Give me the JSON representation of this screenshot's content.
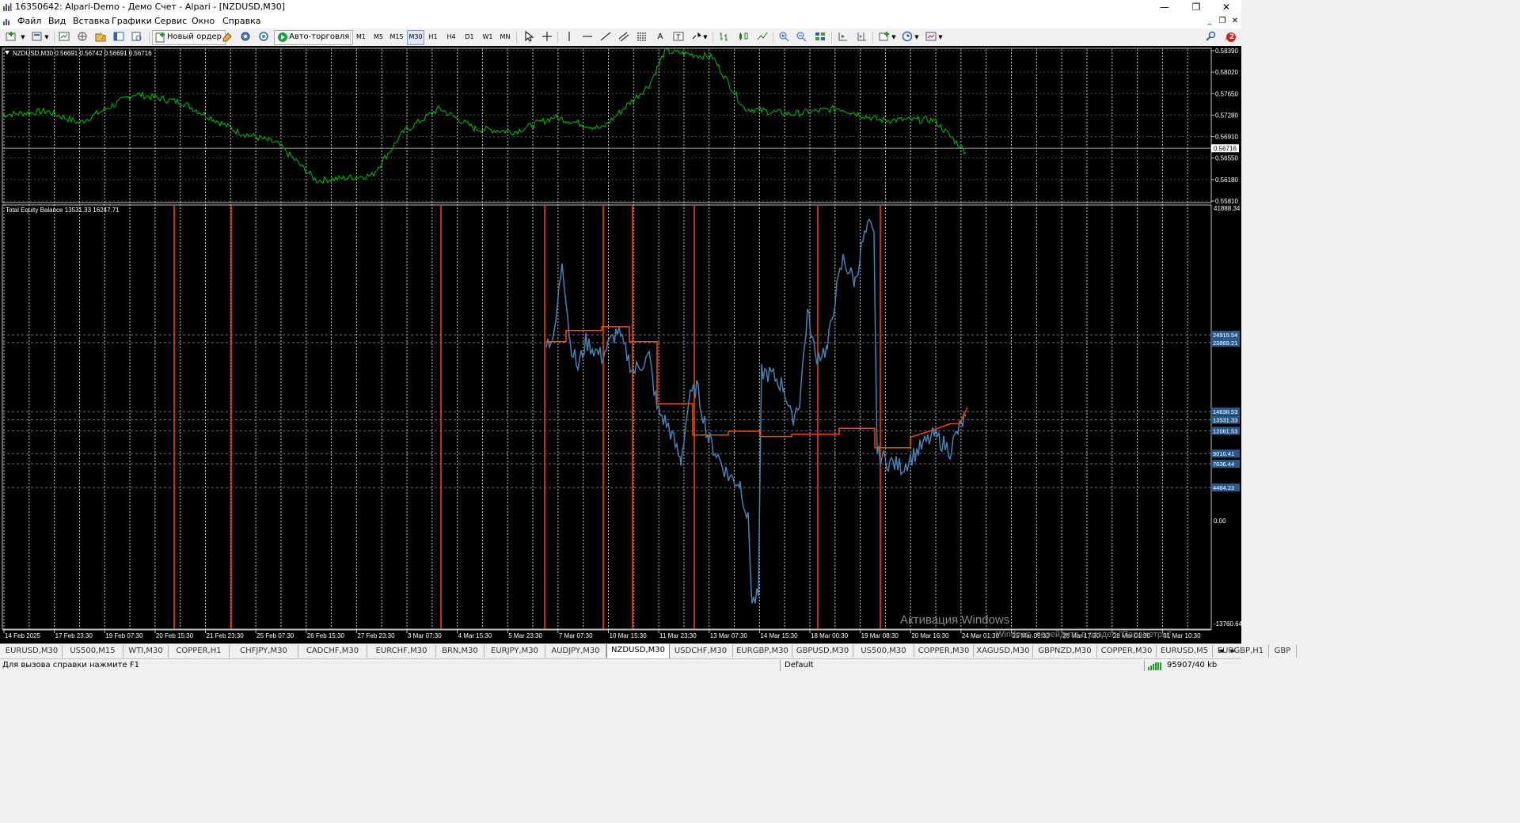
{
  "window": {
    "title": "16350642: Alpari-Demo - Демо Счет - Alpari - [NZDUSD,M30]",
    "minimize": "—",
    "maximize": "❐",
    "close": "✕"
  },
  "menu": {
    "items": [
      "Файл",
      "Вид",
      "Вставка",
      "Графики",
      "Сервис",
      "Окно",
      "Справка"
    ],
    "mdi_minimize": "_",
    "mdi_restore": "❐",
    "mdi_close": "✕"
  },
  "toolbar": {
    "new_order": "Новый ордер",
    "autotrading": "Авто-торговля",
    "timeframes": [
      "M1",
      "M5",
      "M15",
      "M30",
      "H1",
      "H4",
      "D1",
      "W1",
      "MN"
    ],
    "active_timeframe": "M30",
    "notification_count": "2"
  },
  "chart": {
    "main_label": "NZDUSD,M30  0.56691 0.56742 0.56691 0.56716",
    "indicator_label": "Total Equity Balance 13531.33 16247.71",
    "price_axis": [
      "0.58390",
      "0.58020",
      "0.57650",
      "0.57280",
      "0.56910",
      "0.56550",
      "0.56180",
      "0.55810"
    ],
    "current_price": "0.56716",
    "indicator_axis": {
      "top": "41888.34",
      "zero": "0.00",
      "bottom": "-13760.64",
      "levels": [
        "24919.54",
        "23869.21",
        "14638.53",
        "13531.33",
        "12061.53",
        "9010.41",
        "7636.44",
        "4464.23"
      ]
    },
    "time_axis": [
      "14 Feb 2025",
      "17 Feb 23:30",
      "19 Feb 07:30",
      "20 Feb 15:30",
      "21 Feb 23:30",
      "25 Feb 07:30",
      "26 Feb 15:30",
      "27 Feb 23:30",
      "3 Mar 07:30",
      "4 Mar 15:30",
      "5 Mar 23:30",
      "7 Mar 07:30",
      "10 Mar 15:30",
      "11 Mar 23:30",
      "13 Mar 07:30",
      "14 Mar 15:30",
      "18 Mar 00:30",
      "19 Mar 08:30",
      "20 Mar 16:30",
      "24 Mar 01:30",
      "25 Mar 09:30",
      "26 Mar 17:30",
      "28 Mar 01:30",
      "31 Mar 10:30"
    ],
    "watermark_title": "Активация Windows",
    "watermark_text": "Windows, перейдите в раздел \"Параметры\".",
    "colors": {
      "price_line": "#00c000",
      "equity_line": "#4682b4",
      "balance_line": "#ff4500",
      "grid": "#c0c0c0",
      "axis_text": "#ffffff"
    }
  },
  "tabs": {
    "items": [
      "EURUSD,M30",
      "US500,M15",
      "WTI,M30",
      "COPPER,H1",
      "CHFJPY,M30",
      "CADCHF,M30",
      "EURCHF,M30",
      "BRN,M30",
      "EURJPY,M30",
      "AUDJPY,M30",
      "NZDUSD,M30",
      "USDCHF,M30",
      "EURGBP,M30",
      "GBPUSD,M30",
      "US500,M30",
      "COPPER,M30",
      "XAGUSD,M30",
      "GBPNZD,M30",
      "COPPER,M30",
      "EURUSD,M5",
      "EURGBP,H1",
      "GBP"
    ],
    "active": "NZDUSD,M30",
    "left_arrow": "◄",
    "right_arrow": "►"
  },
  "status": {
    "help": "Для вызова справки нажмите F1",
    "profile": "Default",
    "traffic": "95907/40 kb"
  }
}
